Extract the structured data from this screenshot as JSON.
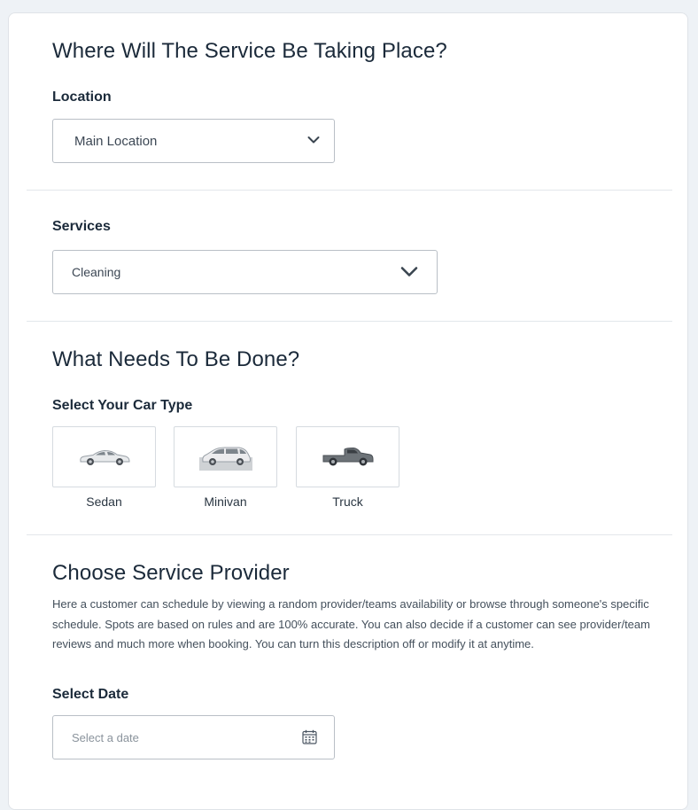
{
  "location_section": {
    "title": "Where Will The Service Be Taking Place?",
    "label": "Location",
    "selected": "Main Location"
  },
  "services_section": {
    "label": "Services",
    "selected": "Cleaning"
  },
  "needs_section": {
    "title": "What Needs To Be Done?",
    "car_type_label": "Select Your Car Type",
    "car_types": [
      {
        "label": "Sedan",
        "icon": "sedan-car-icon"
      },
      {
        "label": "Minivan",
        "icon": "minivan-car-icon"
      },
      {
        "label": "Truck",
        "icon": "truck-icon"
      }
    ]
  },
  "provider_section": {
    "title": "Choose Service Provider",
    "description": "Here a customer can schedule by viewing a random provider/teams availability or browse through someone's specific schedule. Spots are based on rules and are 100% accurate. You can also decide if a customer can see provider/team reviews and much more when booking. You can turn this description off or modify it at anytime.",
    "date_label": "Select Date",
    "date_placeholder": "Select a date",
    "date_icon": "calendar-icon"
  }
}
